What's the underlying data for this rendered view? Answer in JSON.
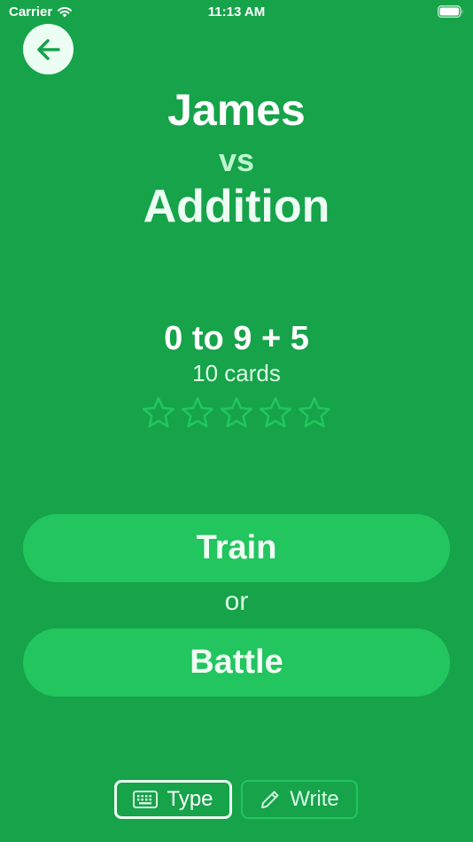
{
  "status_bar": {
    "carrier": "Carrier",
    "time": "11:13 AM"
  },
  "header": {
    "back_icon": "arrow-left-icon"
  },
  "title": {
    "player": "James",
    "vs": "vs",
    "topic": "Addition"
  },
  "level": {
    "range": "0 to 9 + 5",
    "cards": "10 cards",
    "stars_filled": 0,
    "stars_total": 5
  },
  "actions": {
    "train": "Train",
    "or": "or",
    "battle": "Battle"
  },
  "input_modes": {
    "type": "Type",
    "write": "Write",
    "selected": "Type"
  },
  "colors": {
    "background": "#16a34a",
    "button": "#22c55e",
    "star_outline": "#22c55e"
  }
}
